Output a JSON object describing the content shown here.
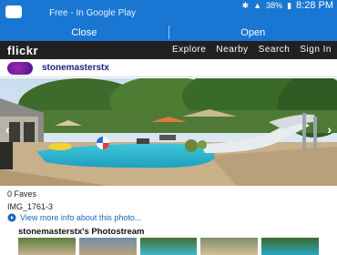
{
  "status_bar": {
    "battery": "38%",
    "time": "8:28 PM"
  },
  "promo": {
    "text": "Free - In Google Play",
    "close_label": "Close",
    "open_label": "Open"
  },
  "nav": {
    "logo": "flickr",
    "links": [
      "Explore",
      "Nearby",
      "Search",
      "Sign In"
    ]
  },
  "user": {
    "name": "stonemasterstx"
  },
  "photo_info": {
    "faves": "0 Faves",
    "title": "IMG_1761-3",
    "more_link": "View more info about this photo..."
  },
  "photostream": {
    "title": "stonemasterstx's Photostream"
  },
  "colors": {
    "promo_bg": "#1976d2",
    "nav_bg": "#212121",
    "link": "#1565c0"
  }
}
